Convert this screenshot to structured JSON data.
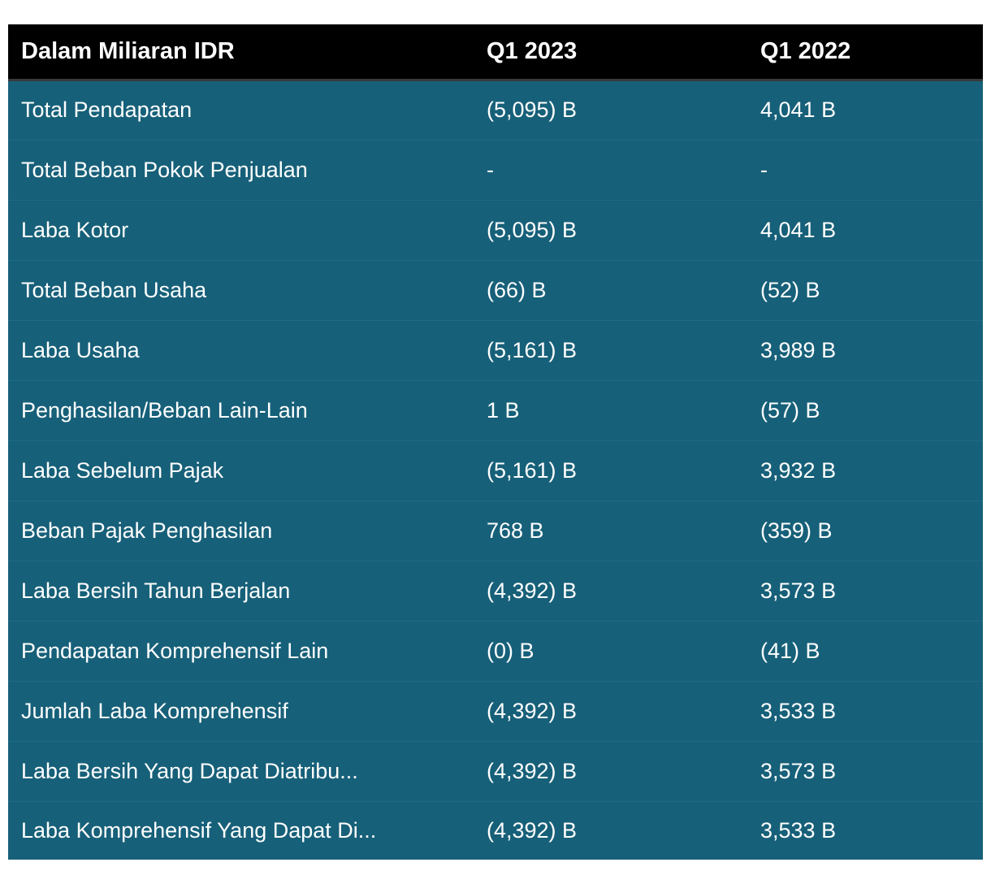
{
  "table": {
    "headers": [
      "Dalam Miliaran IDR",
      "Q1 2023",
      "Q1 2022"
    ],
    "rows": [
      [
        "Total Pendapatan",
        "(5,095) B",
        "4,041 B"
      ],
      [
        "Total Beban Pokok Penjualan",
        "-",
        "-"
      ],
      [
        "Laba Kotor",
        "(5,095) B",
        "4,041 B"
      ],
      [
        "Total Beban Usaha",
        "(66) B",
        "(52) B"
      ],
      [
        "Laba Usaha",
        "(5,161) B",
        "3,989 B"
      ],
      [
        "Penghasilan/Beban Lain-Lain",
        "1 B",
        "(57) B"
      ],
      [
        "Laba Sebelum Pajak",
        "(5,161) B",
        "3,932 B"
      ],
      [
        "Beban Pajak Penghasilan",
        "768 B",
        "(359) B"
      ],
      [
        "Laba Bersih Tahun Berjalan",
        "(4,392) B",
        "3,573 B"
      ],
      [
        "Pendapatan Komprehensif Lain",
        "(0) B",
        "(41) B"
      ],
      [
        "Jumlah Laba Komprehensif",
        "(4,392) B",
        "3,533 B"
      ],
      [
        "Laba Bersih Yang Dapat Diatribu...",
        "(4,392) B",
        "3,573 B"
      ],
      [
        "Laba Komprehensif Yang Dapat Di...",
        "(4,392) B",
        "3,533 B"
      ]
    ]
  },
  "colors": {
    "header_bg": "#000000",
    "body_bg": "#176079",
    "text": "#ffffff"
  }
}
